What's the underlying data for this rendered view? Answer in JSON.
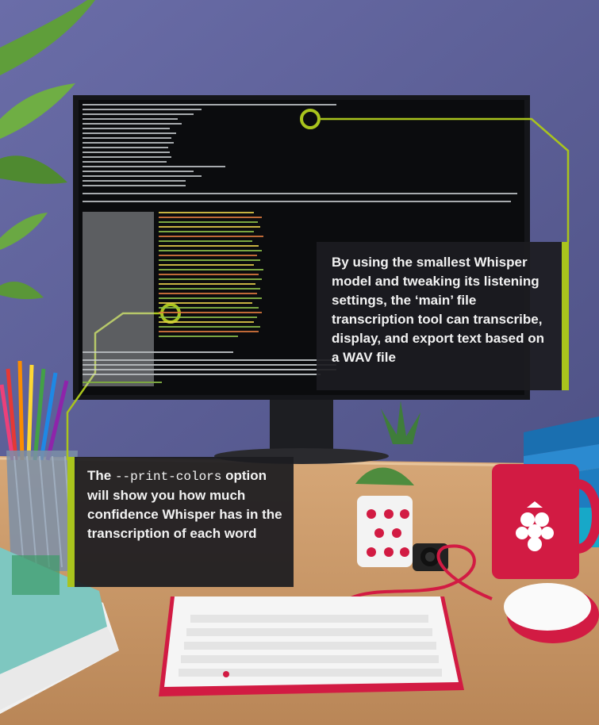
{
  "callouts": {
    "whisper_model": "By using the smallest Whisper model and tweaking its listening settings, the ‘main’ file transcription tool can transcribe, display, and export text based on a WAV file",
    "print_colors_pre": "The ",
    "print_colors_code": "--print-colors",
    "print_colors_post": " option will show you how much confidence Whisper has in the transcription of each word"
  },
  "colors": {
    "accent": "#a9c41d",
    "callout_bg": "#1c1c20",
    "wall": "#5c5f99",
    "desk": "#c99a6a",
    "raspberry_red": "#d21b43"
  },
  "objects": [
    "monitor",
    "terminal-text",
    "keyboard",
    "mouse",
    "mug",
    "plant",
    "pencil-holder",
    "books",
    "magazines",
    "camera"
  ]
}
